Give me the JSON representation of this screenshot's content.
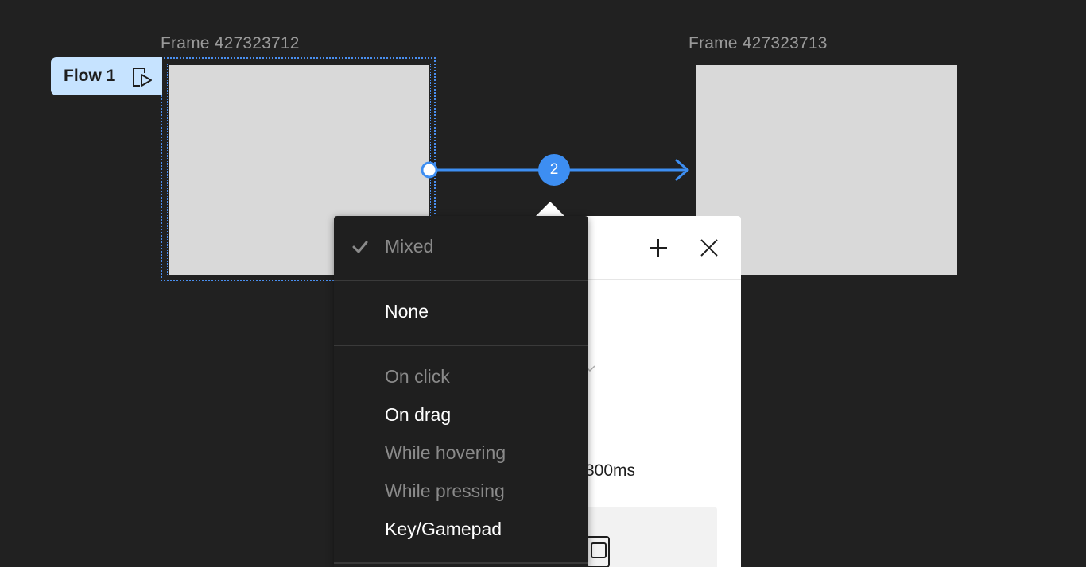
{
  "canvas": {
    "background": "#212121",
    "accent": "#3d8ef2"
  },
  "frames": {
    "source_label": "Frame 427323712",
    "target_label": "Frame 427323713"
  },
  "flow": {
    "label": "Flow 1",
    "icon": "play-flow-icon"
  },
  "connection": {
    "badge": "2"
  },
  "interaction_panel": {
    "add_icon": "plus-icon",
    "close_icon": "close-icon",
    "duration": "300ms"
  },
  "trigger_menu": {
    "current": "Mixed",
    "none_option": "None",
    "options": [
      {
        "label": "On click",
        "enabled": false
      },
      {
        "label": "On drag",
        "enabled": true
      },
      {
        "label": "While hovering",
        "enabled": false
      },
      {
        "label": "While pressing",
        "enabled": false
      },
      {
        "label": "Key/Gamepad",
        "enabled": true
      }
    ]
  }
}
